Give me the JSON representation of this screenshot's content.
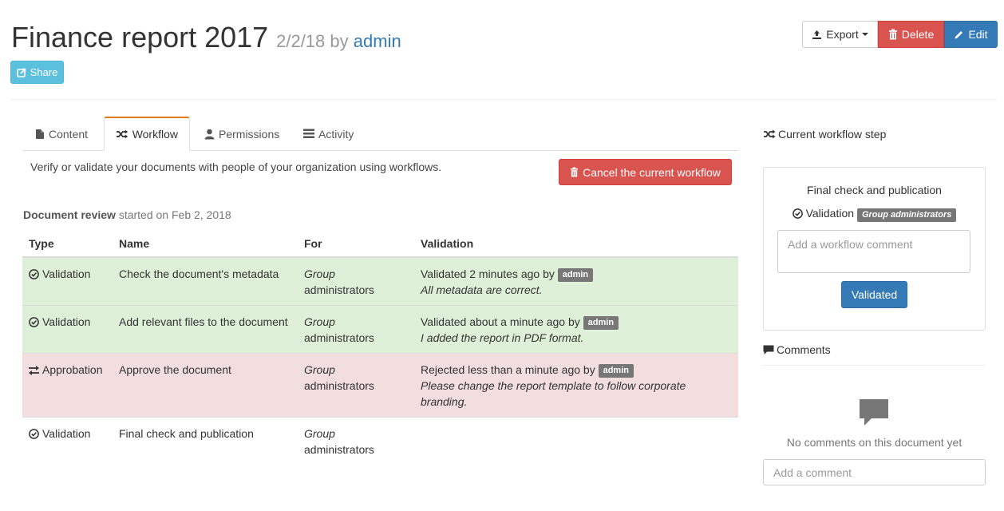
{
  "document": {
    "title": "Finance report 2017",
    "date": "2/2/18",
    "by": "by",
    "author": "admin"
  },
  "toolbar": {
    "share_label": "Share",
    "export_label": "Export",
    "delete_label": "Delete",
    "edit_label": "Edit"
  },
  "tabs": [
    {
      "label": "Content",
      "icon": "file-icon",
      "active": false
    },
    {
      "label": "Workflow",
      "icon": "shuffle-icon",
      "active": true
    },
    {
      "label": "Permissions",
      "icon": "user-icon",
      "active": false
    },
    {
      "label": "Activity",
      "icon": "list-icon",
      "active": false
    }
  ],
  "workflow": {
    "description": "Verify or validate your documents with people of your organization using workflows.",
    "cancel_label": "Cancel the current workflow",
    "review_name": "Document review",
    "review_started": "started on Feb 2, 2018",
    "columns": [
      "Type",
      "Name",
      "For",
      "Validation"
    ],
    "rows": [
      {
        "status": "success",
        "type": "Validation",
        "type_icon": "check-circle-icon",
        "name": "Check the document's metadata",
        "for_group": "Group",
        "for_name": "administrators",
        "validation": "Validated 2 minutes ago by",
        "validator": "admin",
        "comment": "All metadata are correct."
      },
      {
        "status": "success",
        "type": "Validation",
        "type_icon": "check-circle-icon",
        "name": "Add relevant files to the document",
        "for_group": "Group",
        "for_name": "administrators",
        "validation": "Validated about a minute ago by",
        "validator": "admin",
        "comment": "I added the report in PDF format."
      },
      {
        "status": "danger",
        "type": "Approbation",
        "type_icon": "transfer-icon",
        "name": "Approve the document",
        "for_group": "Group",
        "for_name": "administrators",
        "validation": "Rejected less than a minute ago by",
        "validator": "admin",
        "comment": "Please change the report template to follow corporate branding."
      },
      {
        "status": "plain",
        "type": "Validation",
        "type_icon": "check-circle-icon",
        "name": "Final check and publication",
        "for_group": "Group",
        "for_name": "administrators",
        "validation": "",
        "validator": "",
        "comment": ""
      }
    ]
  },
  "current_step": {
    "heading": "Current workflow step",
    "title": "Final check and publication",
    "type": "Validation",
    "group_badge": "Group administrators",
    "comment_placeholder": "Add a workflow comment",
    "validated_label": "Validated"
  },
  "comments": {
    "heading": "Comments",
    "empty_text": "No comments on this document yet",
    "add_placeholder": "Add a comment"
  },
  "colors": {
    "primary": "#337ab7",
    "danger": "#d9534f",
    "info": "#5bc0de",
    "success_row": "#dff0d8",
    "danger_row": "#f2dede",
    "active_tab_accent": "#e07a1f"
  }
}
